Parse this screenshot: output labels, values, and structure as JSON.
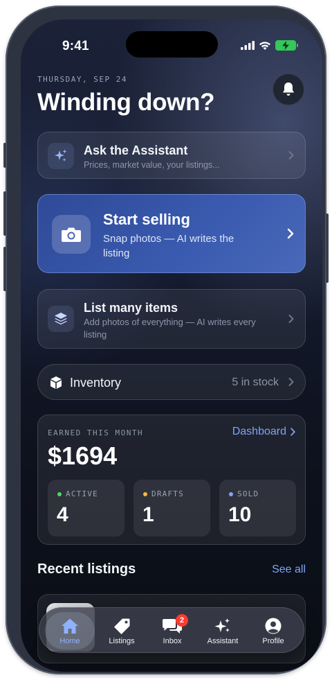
{
  "status": {
    "time": "9:41"
  },
  "header": {
    "date": "THURSDAY, SEP 24",
    "headline": "Winding down?"
  },
  "assistant_card": {
    "title": "Ask the Assistant",
    "subtitle": "Prices, market value, your listings..."
  },
  "sell_card": {
    "title": "Start selling",
    "subtitle": "Snap photos — AI writes the listing"
  },
  "bulk_card": {
    "title": "List many items",
    "subtitle": "Add photos of everything — AI writes every listing"
  },
  "inventory": {
    "label": "Inventory",
    "count": "5 in stock"
  },
  "earnings": {
    "label": "EARNED THIS MONTH",
    "dashboard_label": "Dashboard",
    "amount": "$1694",
    "stats": [
      {
        "label": "ACTIVE",
        "value": "4",
        "dot_color": "#4cd964"
      },
      {
        "label": "DRAFTS",
        "value": "1",
        "dot_color": "#f5b942"
      },
      {
        "label": "SOLD",
        "value": "10",
        "dot_color": "#7fa4f5"
      }
    ]
  },
  "recent": {
    "title": "Recent listings",
    "see_all": "See all"
  },
  "tabbar": {
    "tabs": [
      {
        "label": "Home",
        "icon": "house-icon",
        "active": true
      },
      {
        "label": "Listings",
        "icon": "tag-icon"
      },
      {
        "label": "Inbox",
        "icon": "chat-bubbles-icon",
        "badge": "2"
      },
      {
        "label": "Assistant",
        "icon": "sparkles-icon"
      },
      {
        "label": "Profile",
        "icon": "person-circle-icon"
      }
    ]
  },
  "colors": {
    "accent": "#7fa4f5",
    "sell_card": "#3a5bb0",
    "badge": "#ff3b30",
    "active_tab": "#8fb2ff"
  }
}
